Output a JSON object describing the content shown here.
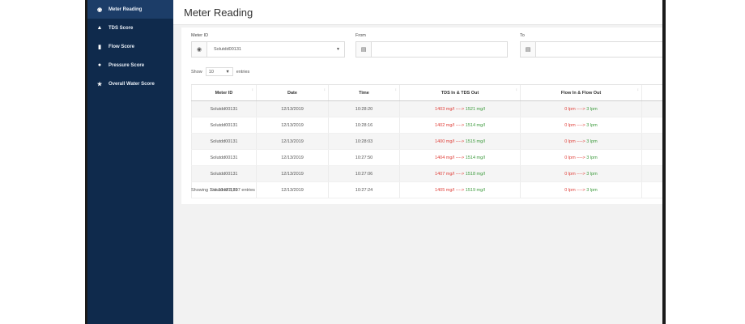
{
  "sidebar": {
    "items": [
      {
        "label": "Meter Reading",
        "icon": "meter-icon",
        "active": true
      },
      {
        "label": "TDS Score",
        "icon": "flask-icon"
      },
      {
        "label": "Flow Score",
        "icon": "flow-icon"
      },
      {
        "label": "Pressure Score",
        "icon": "pressure-icon"
      },
      {
        "label": "Overall Water Score",
        "icon": "star-icon"
      }
    ]
  },
  "header": {
    "title": "Meter Reading"
  },
  "filters": {
    "meter_label": "Meter ID",
    "meter_value": "Solutdd00131",
    "from_label": "From",
    "to_label": "To"
  },
  "table_controls": {
    "show": "Show",
    "entries_value": "10",
    "entries": "entries"
  },
  "table": {
    "headers": [
      "Meter ID",
      "Date",
      "Time",
      "TDS In & TDS Out",
      "Flow In & Flow Out",
      ""
    ],
    "rows": [
      {
        "meter_id": "Solutdd00131",
        "date": "12/13/2019",
        "time": "10:28:20",
        "tds_in": "1403 mg/l",
        "tds_out": "1521 mg/l",
        "flow_in": "0 lpm",
        "flow_out": "3 lpm"
      },
      {
        "meter_id": "Solutdd00131",
        "date": "12/13/2019",
        "time": "10:28:16",
        "tds_in": "1402 mg/l",
        "tds_out": "1514 mg/l",
        "flow_in": "0 lpm",
        "flow_out": "3 lpm"
      },
      {
        "meter_id": "Solutdd00131",
        "date": "12/13/2019",
        "time": "10:28:03",
        "tds_in": "1400 mg/l",
        "tds_out": "1515 mg/l",
        "flow_in": "0 lpm",
        "flow_out": "3 lpm"
      },
      {
        "meter_id": "Solutdd00131",
        "date": "12/13/2019",
        "time": "10:27:50",
        "tds_in": "1404 mg/l",
        "tds_out": "1514 mg/l",
        "flow_in": "0 lpm",
        "flow_out": "3 lpm"
      },
      {
        "meter_id": "Solutdd00131",
        "date": "12/13/2019",
        "time": "10:27:06",
        "tds_in": "1407 mg/l",
        "tds_out": "1518 mg/l",
        "flow_in": "0 lpm",
        "flow_out": "3 lpm"
      },
      {
        "meter_id": "Solutdd00131",
        "date": "12/13/2019",
        "time": "10:27:24",
        "tds_in": "1405 mg/l",
        "tds_out": "1519 mg/l",
        "flow_in": "0 lpm",
        "flow_out": "3 lpm"
      }
    ],
    "arrow": "---->",
    "info": "Showing 1 to 10 of 3,897 entries"
  },
  "colors": {
    "sidebar": "#0f2a4c",
    "in_value": "#e0403a",
    "out_value": "#3c9a3c"
  }
}
